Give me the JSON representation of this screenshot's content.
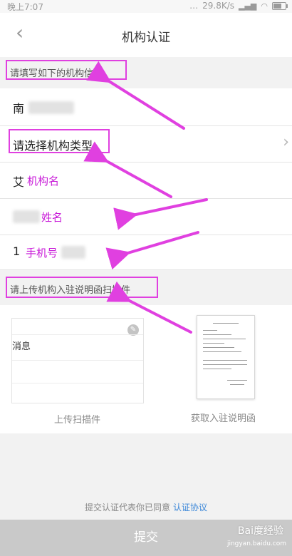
{
  "status_bar": {
    "time": "晚上7:07",
    "speed": "29.8K/s",
    "signal": "…",
    "battery_level": 0.7
  },
  "nav": {
    "title": "机构认证",
    "back_icon": "chevron-left-icon"
  },
  "form": {
    "section1": "请填写如下的机构信息",
    "org_name_prefix": "南",
    "org_type_placeholder": "请选择机构类型",
    "contact_prefix": "艾",
    "contact_annotation": "机构名",
    "name_annotation": "姓名",
    "phone_prefix": "1",
    "phone_annotation": "手机号",
    "section2": "请上传机构入驻说明函扫描件"
  },
  "upload": {
    "card_message": "消息",
    "upload_caption": "上传扫描件",
    "doc_caption": "获取入驻说明函"
  },
  "footer": {
    "agree_text": "提交认证代表你已同意",
    "agree_link": "认证协议",
    "submit_label": "提交"
  },
  "watermark": {
    "logo": "Bai度经验",
    "site": "jingyan.baidu.com"
  },
  "colors": {
    "annotation": "#c81ad8",
    "link": "#3a86d8",
    "submit_bg": "#c9c9c9"
  }
}
